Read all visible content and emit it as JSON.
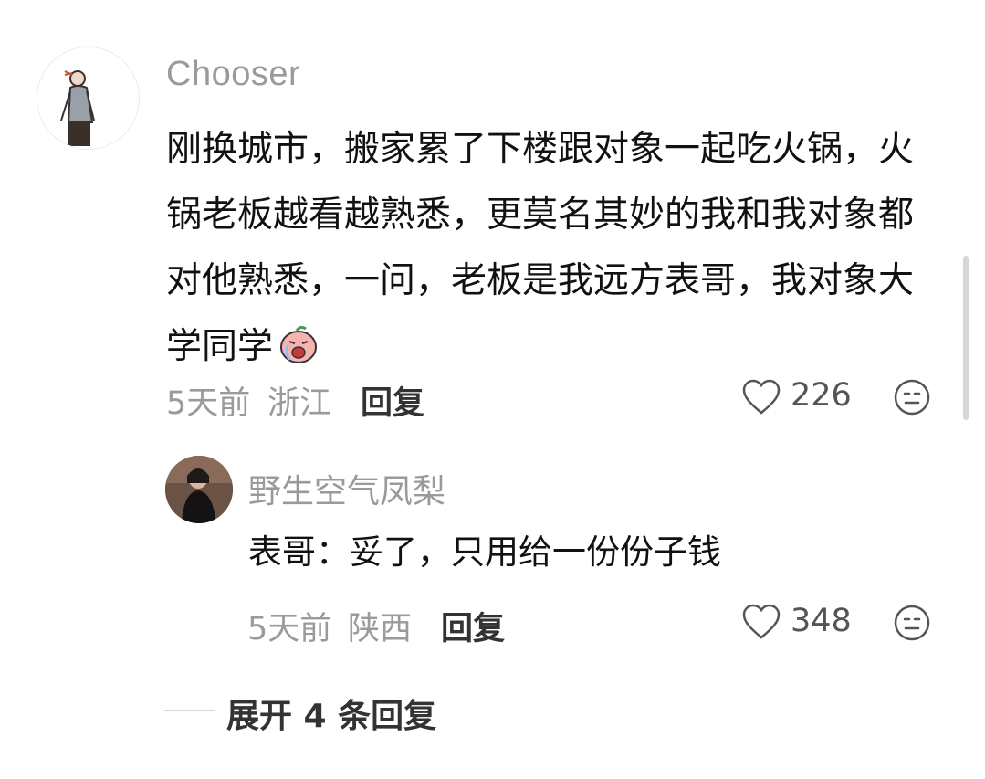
{
  "comment": {
    "username": "Chooser",
    "text": "刚换城市，搬家累了下楼跟对象一起吃火锅，火锅老板越看越熟悉，更莫名其妙的我和我对象都对他熟悉，一问，老板是我远方表哥，我对象大学同学",
    "emoji": "crying-face-sticker",
    "time": "5天前",
    "location": "浙江",
    "reply_label": "回复",
    "likes": "226"
  },
  "reply": {
    "username": "野生空气凤梨",
    "text": "表哥：妥了，只用给一份份子钱",
    "time": "5天前",
    "location": "陕西",
    "reply_label": "回复",
    "likes": "348"
  },
  "expand": {
    "label": "展开 4 条回复"
  },
  "icons": {
    "like": "heart-outline-icon",
    "dislike": "neutral-face-icon"
  },
  "colors": {
    "secondary_text": "#9a9a9a",
    "primary_text": "#111111"
  }
}
